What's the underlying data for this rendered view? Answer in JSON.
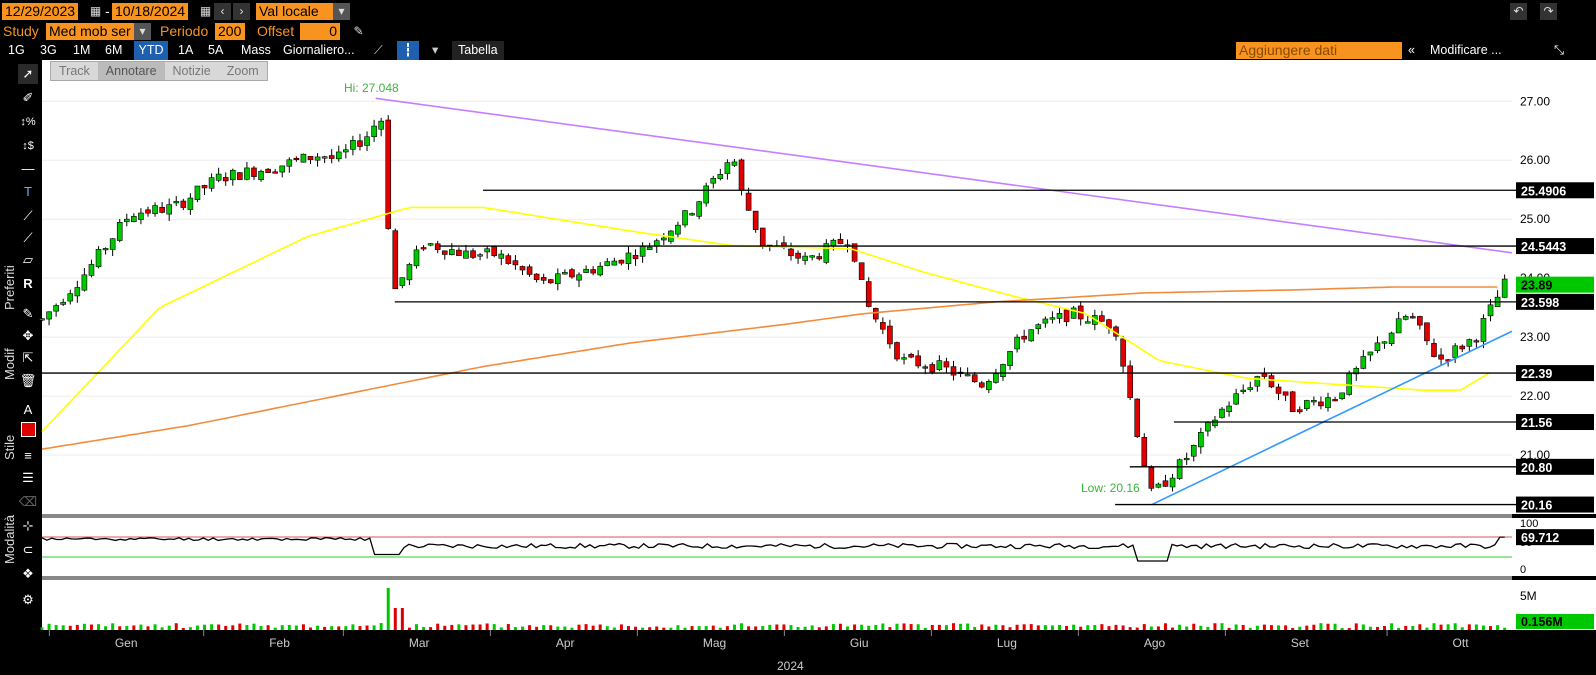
{
  "header": {
    "start_date": "12/29/2023",
    "end_date": "10/18/2024",
    "currency": "Val locale",
    "study_label": "Study",
    "study_value": "Med mob ser",
    "period_label": "Periodo",
    "period_value": "200",
    "offset_label": "Offset",
    "offset_value": "0"
  },
  "range_tabs": [
    "1G",
    "3G",
    "1M",
    "6M",
    "YTD",
    "1A",
    "5A",
    "Mass",
    "Giornaliero..."
  ],
  "active_tab": "YTD",
  "table_label": "Tabella",
  "add_data_placeholder": "Aggiungere dati",
  "edit_label": "Modificare ...",
  "subtools": [
    "Track",
    "Annotare",
    "Notizie",
    "Zoom"
  ],
  "side_labels": {
    "preferiti": "Preferiti",
    "modif": "Modif",
    "stile": "Stile",
    "modalita": "Modalità"
  },
  "colors": {
    "up": "#00c800",
    "down": "#e00000",
    "ma50": "#ffff00",
    "ma200": "#f28c3c",
    "trend_down": "#c77dff",
    "trend_up": "#3399ff"
  },
  "chart_data": {
    "type": "candlestick",
    "title": "",
    "xlabel": "2024",
    "x_ticks": [
      "Gen",
      "Feb",
      "Mar",
      "Apr",
      "Mag",
      "Giu",
      "Lug",
      "Ago",
      "Set",
      "Ott"
    ],
    "y_ticks": [
      "27.00",
      "26.00",
      "25.00",
      "24.00",
      "23.00",
      "22.00",
      "21.00"
    ],
    "ylim": [
      20.0,
      27.7
    ],
    "annotations": {
      "hi": "Hi: 27.048",
      "low": "Low: 20.16"
    },
    "levels": [
      {
        "label": "25.4906",
        "value": 25.4906,
        "start": 0.3
      },
      {
        "label": "24.5443",
        "value": 24.5443,
        "start": 0.27
      },
      {
        "label": "23.598",
        "value": 23.598,
        "start": 0.24
      },
      {
        "label": "22.39",
        "value": 22.39,
        "start": 0.0
      },
      {
        "label": "21.56",
        "value": 21.56,
        "start": 0.77
      },
      {
        "label": "20.80",
        "value": 20.8,
        "start": 0.74
      },
      {
        "label": "20.16",
        "value": 20.16,
        "start": 0.73
      }
    ],
    "last_price": "23.89",
    "price_anchors": [
      [
        0,
        23.3
      ],
      [
        0.03,
        24.1
      ],
      [
        0.06,
        25.1
      ],
      [
        0.09,
        25.2
      ],
      [
        0.12,
        25.7
      ],
      [
        0.16,
        25.9
      ],
      [
        0.19,
        26.1
      ],
      [
        0.2,
        26.0
      ],
      [
        0.225,
        26.5
      ],
      [
        0.23,
        27.0
      ],
      [
        0.234,
        25.3
      ],
      [
        0.24,
        23.8
      ],
      [
        0.26,
        24.6
      ],
      [
        0.29,
        24.4
      ],
      [
        0.31,
        24.4
      ],
      [
        0.34,
        23.9
      ],
      [
        0.38,
        24.2
      ],
      [
        0.41,
        24.5
      ],
      [
        0.44,
        25.1
      ],
      [
        0.47,
        26.1
      ],
      [
        0.475,
        25.5
      ],
      [
        0.49,
        24.6
      ],
      [
        0.52,
        24.3
      ],
      [
        0.55,
        24.7
      ],
      [
        0.56,
        23.6
      ],
      [
        0.585,
        22.6
      ],
      [
        0.61,
        22.5
      ],
      [
        0.64,
        22.2
      ],
      [
        0.67,
        23.1
      ],
      [
        0.7,
        23.4
      ],
      [
        0.73,
        23.2
      ],
      [
        0.745,
        21.4
      ],
      [
        0.755,
        20.3
      ],
      [
        0.78,
        21.0
      ],
      [
        0.8,
        21.7
      ],
      [
        0.83,
        22.4
      ],
      [
        0.85,
        21.8
      ],
      [
        0.88,
        22.0
      ],
      [
        0.91,
        22.9
      ],
      [
        0.93,
        23.4
      ],
      [
        0.95,
        22.6
      ],
      [
        0.975,
        23.0
      ],
      [
        0.995,
        23.89
      ]
    ],
    "ma50_anchors": [
      [
        0,
        21.4
      ],
      [
        0.08,
        23.5
      ],
      [
        0.18,
        24.7
      ],
      [
        0.25,
        25.2
      ],
      [
        0.3,
        25.2
      ],
      [
        0.4,
        24.8
      ],
      [
        0.47,
        24.55
      ],
      [
        0.55,
        24.5
      ],
      [
        0.6,
        24.1
      ],
      [
        0.66,
        23.7
      ],
      [
        0.71,
        23.4
      ],
      [
        0.76,
        22.6
      ],
      [
        0.82,
        22.3
      ],
      [
        0.88,
        22.2
      ],
      [
        0.94,
        22.1
      ],
      [
        0.965,
        22.1
      ],
      [
        0.985,
        22.4
      ]
    ],
    "ma200_anchors": [
      [
        0,
        21.1
      ],
      [
        0.1,
        21.5
      ],
      [
        0.2,
        22.0
      ],
      [
        0.3,
        22.5
      ],
      [
        0.4,
        22.9
      ],
      [
        0.5,
        23.2
      ],
      [
        0.56,
        23.4
      ],
      [
        0.65,
        23.6
      ],
      [
        0.75,
        23.75
      ],
      [
        0.85,
        23.8
      ],
      [
        0.92,
        23.85
      ],
      [
        0.99,
        23.85
      ]
    ],
    "trend_down": [
      [
        0.227,
        27.05
      ],
      [
        1.0,
        24.43
      ]
    ],
    "trend_up": [
      [
        0.755,
        20.16
      ],
      [
        1.0,
        23.1
      ]
    ],
    "rsi": {
      "value_label": "69.712",
      "ticks": [
        "100",
        "50",
        "0"
      ],
      "upper": 70,
      "lower": 30
    },
    "volume": {
      "label": "0.156M",
      "tick": "5M"
    }
  }
}
